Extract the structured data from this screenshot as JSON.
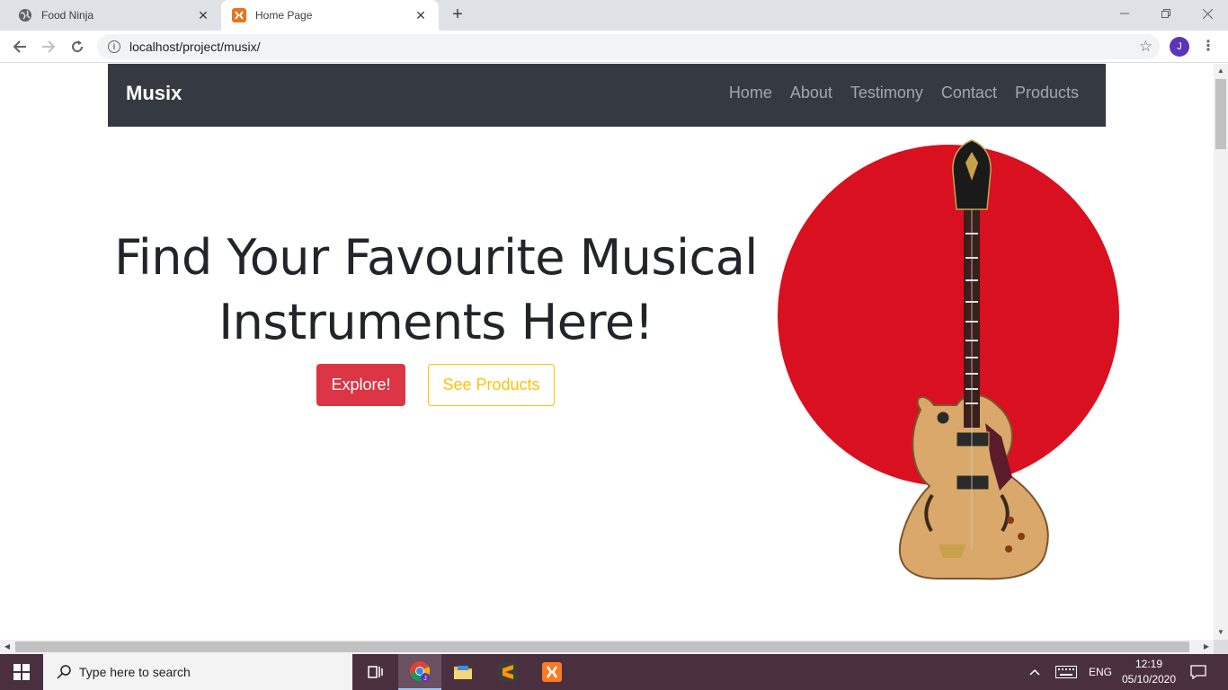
{
  "browser": {
    "tabs": [
      {
        "title": "Food Ninja",
        "icon": "globe-icon",
        "active": false
      },
      {
        "title": "Home Page",
        "icon": "xampp-icon",
        "active": true
      }
    ],
    "url": "localhost/project/musix/",
    "profile_initial": "J"
  },
  "site": {
    "brand": "Musix",
    "nav": [
      "Home",
      "About",
      "Testimony",
      "Contact",
      "Products"
    ],
    "hero": {
      "title_line1": "Find Your Favourite Musical",
      "title_line2": "Instruments Here!",
      "primary_button": "Explore!",
      "secondary_button": "See Products"
    },
    "colors": {
      "navbar": "#343a40",
      "primary": "#dc3545",
      "warning": "#ffc107",
      "circle": "#d91020"
    }
  },
  "taskbar": {
    "search_placeholder": "Type here to search",
    "language": "ENG",
    "time": "12:19",
    "date": "05/10/2020"
  }
}
